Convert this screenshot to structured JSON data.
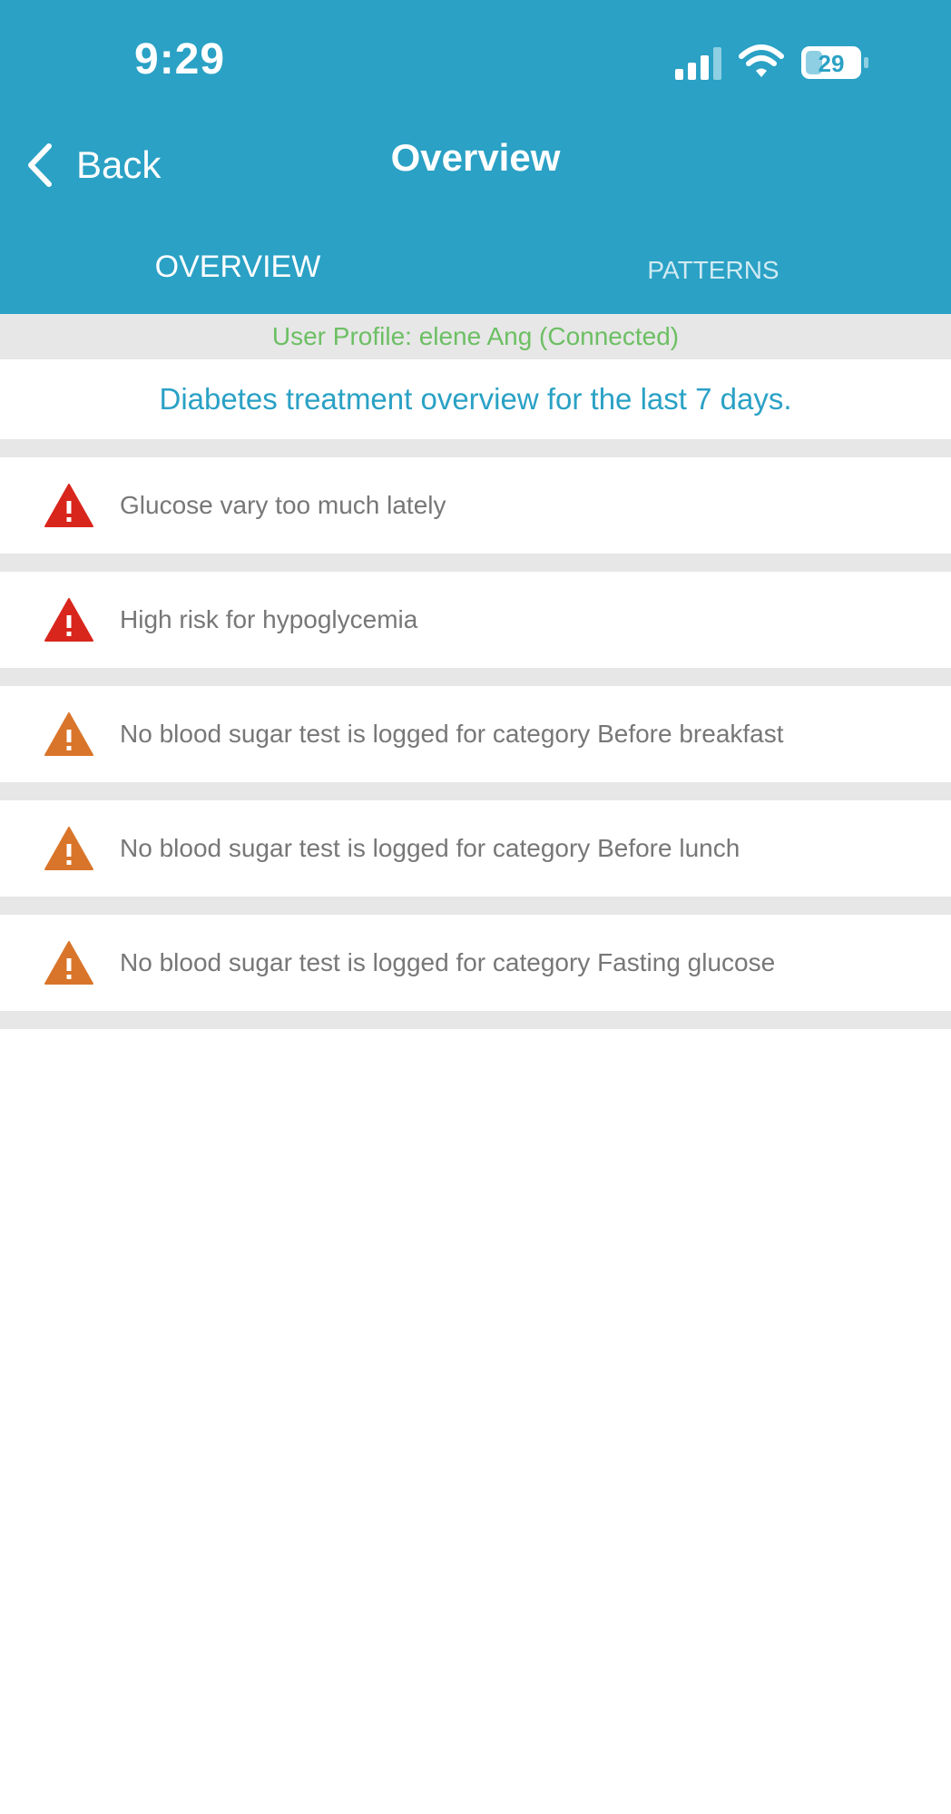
{
  "status_bar": {
    "time": "9:29",
    "battery_level": "29"
  },
  "nav": {
    "back_label": "Back",
    "title": "Overview"
  },
  "tabs": [
    {
      "label": "OVERVIEW",
      "active": true
    },
    {
      "label": "PATTERNS",
      "active": false
    }
  ],
  "profile": {
    "status_text": "User Profile: elene Ang (Connected)"
  },
  "summary": {
    "text": "Diabetes treatment overview for the last 7 days."
  },
  "alerts": [
    {
      "text": "Glucose vary too much lately",
      "severity": "high",
      "icon": "warning-icon-red"
    },
    {
      "text": "High risk for hypoglycemia",
      "severity": "high",
      "icon": "warning-icon-red"
    },
    {
      "text": "No blood sugar test is logged for category Before breakfast",
      "severity": "medium",
      "icon": "warning-icon-orange"
    },
    {
      "text": "No blood sugar test is logged for category Before lunch",
      "severity": "medium",
      "icon": "warning-icon-orange"
    },
    {
      "text": "No blood sugar test is logged for category Fasting glucose",
      "severity": "medium",
      "icon": "warning-icon-orange"
    }
  ],
  "colors": {
    "header_bg": "#2aa1c5",
    "profile_text": "#6cbf63",
    "summary_text": "#2aa1c5",
    "alert_high": "#d9261c",
    "alert_medium": "#d9752a",
    "alert_text": "#777777"
  }
}
